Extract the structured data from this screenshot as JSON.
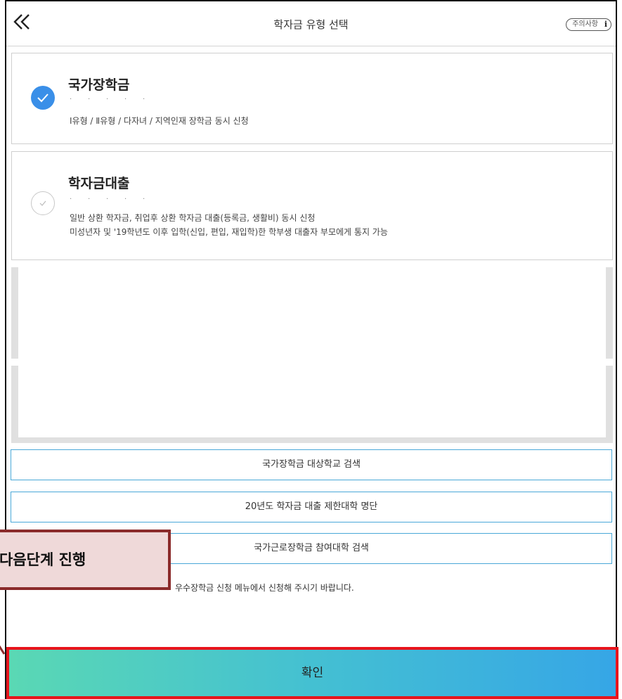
{
  "header": {
    "title": "학자금 유형 선택",
    "back_icon": "double-chevron-left-icon",
    "notice_label": "주의사항",
    "notice_icon": "i"
  },
  "options": [
    {
      "title": "국가장학금",
      "selected": true,
      "description_lines": [
        "Ⅰ유형 / Ⅱ유형 / 다자녀 / 지역인재 장학금 동시 신청"
      ]
    },
    {
      "title": "학자금대출",
      "selected": false,
      "description_lines": [
        "일반 상환 학자금, 취업후 상환 학자금 대출(등록금, 생활비) 동시 신청",
        "미성년자 및 '19학년도 이후 입학(신입, 편입, 재입학)한 학부생 대출자 부모에게 통지 가능"
      ]
    }
  ],
  "links": [
    "국가장학금 대상학교 검색",
    "20년도 학자금 대출 제한대학 명단",
    "국가근로장학금 참여대학 검색"
  ],
  "footnote": "우수장학금 신청 메뉴에서 신청해 주시기 바랍니다.",
  "callout": "다음단계 진행",
  "confirm_label": "확인",
  "colors": {
    "selected": "#3a8fe8",
    "link_border": "#4aa8d8",
    "highlight_border": "#e8141c",
    "callout_border": "#8b2b2b",
    "callout_bg": "#efd9d9"
  }
}
